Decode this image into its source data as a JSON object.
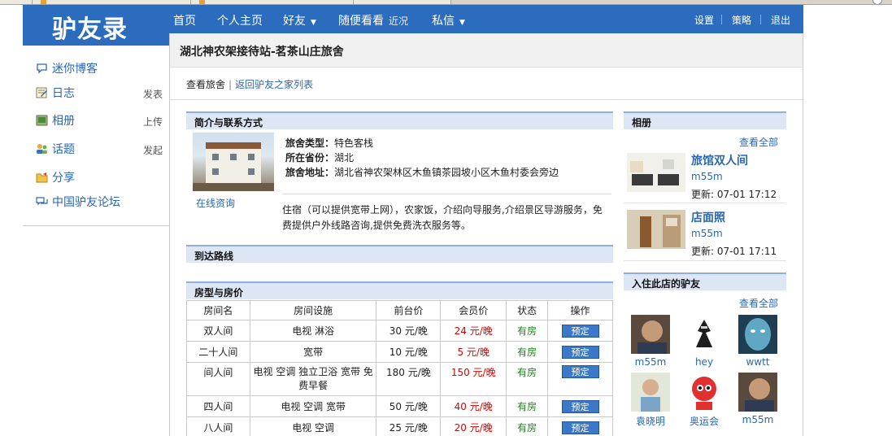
{
  "brand": {
    "logo_text": "驴友录"
  },
  "nav": {
    "items": [
      {
        "label": "首页",
        "caret": ""
      },
      {
        "label": "个人主页",
        "caret": ""
      },
      {
        "label": "好友",
        "caret": "▼"
      },
      {
        "label": "随便看看",
        "caret": "",
        "sub": "近况"
      },
      {
        "label": "私信",
        "caret": "▼"
      }
    ],
    "right": [
      "设置",
      "策略",
      "退出"
    ]
  },
  "sidebar": {
    "items": [
      {
        "label": "迷你博客",
        "action": "",
        "icon": "speech-bubble-icon"
      },
      {
        "label": "日志",
        "action": "发表",
        "icon": "notepad-icon"
      },
      {
        "label": "相册",
        "action": "上传",
        "icon": "picture-icon"
      },
      {
        "label": "话题",
        "action": "发起",
        "icon": "people-icon"
      },
      {
        "label": "分享",
        "action": "",
        "icon": "folder-icon"
      },
      {
        "label": "中国驴友论坛",
        "action": "",
        "icon": "speech-bubble-icon"
      }
    ]
  },
  "page": {
    "title": "湖北神农架接待站-茗茶山庄旅舍",
    "crumb_current": "查看旅舍",
    "crumb_link": "返回驴友之家列表"
  },
  "intro": {
    "heading": "简介与联系方式",
    "online_consult": "在线资询",
    "type_label": "旅舍类型：",
    "type_value": "特色客栈",
    "province_label": "所在省份：",
    "province_value": "湖北",
    "address_label": "旅舍地址：",
    "address_value": "湖北省神农架林区木鱼镇茶园坡小区木鱼村委会旁边",
    "description": "住宿（可以提供宽带上网），农家饭，介绍向导服务,介绍景区导游服务，免费提供户外线路咨询,提供免费洗衣服务等。"
  },
  "route": {
    "heading": "到达路线"
  },
  "rooms": {
    "heading": "房型与房价",
    "columns": [
      "房间名",
      "房间设施",
      "前台价",
      "会员价",
      "状态",
      "操作"
    ],
    "rows": [
      {
        "name": "双人间",
        "facilities": "电视 淋浴",
        "front_price": "30 元/晚",
        "member_price": "24 元/晚",
        "status": "有房",
        "action": "预定"
      },
      {
        "name": "二十人间",
        "facilities": "宽带",
        "front_price": "10 元/晚",
        "member_price": "5 元/晚",
        "status": "有房",
        "action": "预定"
      },
      {
        "name": "间人间",
        "facilities": "电视 空调 独立卫浴 宽带 免费早餐",
        "front_price": "180 元/晚",
        "member_price": "150 元/晚",
        "status": "有房",
        "action": "预定"
      },
      {
        "name": "四人间",
        "facilities": "电视 空调 宽带",
        "front_price": "50 元/晚",
        "member_price": "40 元/晚",
        "status": "有房",
        "action": "预定"
      },
      {
        "name": "八人间",
        "facilities": "电视 空调",
        "front_price": "25 元/晚",
        "member_price": "20 元/晚",
        "status": "有房",
        "action": "预定"
      }
    ]
  },
  "albums": {
    "heading": "相册",
    "view_all": "查看全部",
    "items": [
      {
        "title": "旅馆双人间",
        "user": "m55m",
        "updated": "更新: 07-01 17:12"
      },
      {
        "title": "店面照",
        "user": "m55m",
        "updated": "更新: 07-01 17:11"
      }
    ]
  },
  "guests": {
    "heading": "入住此店的驴友",
    "view_all": "查看全部",
    "items": [
      {
        "name": "m55m"
      },
      {
        "name": "hey"
      },
      {
        "name": "wwtt"
      },
      {
        "name": "袁晓明"
      },
      {
        "name": "奥运会"
      },
      {
        "name": "m55m"
      }
    ]
  }
}
